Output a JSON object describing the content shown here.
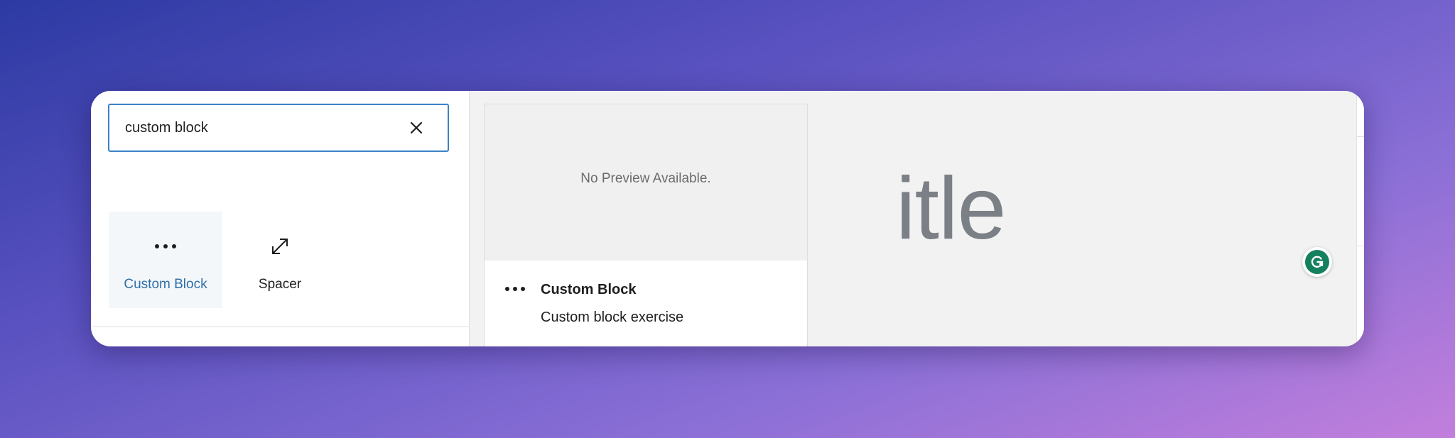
{
  "inserter": {
    "search": {
      "value": "custom block",
      "clear_icon": "close-icon"
    },
    "blocks": [
      {
        "label": "Custom Block",
        "icon": "more-horizontal-icon",
        "selected": true
      },
      {
        "label": "Spacer",
        "icon": "resize-diagonal-icon",
        "selected": false
      }
    ]
  },
  "preview": {
    "empty_text": "No Preview Available.",
    "icon": "more-horizontal-icon",
    "title": "Custom Block",
    "description": "Custom block exercise"
  },
  "editor": {
    "title_visible_fragment": "itle",
    "grammarly_icon": "grammarly-icon"
  },
  "colors": {
    "accent": "#3b82c4",
    "selected_label": "#2f6fa8",
    "grammarly": "#15805e"
  }
}
